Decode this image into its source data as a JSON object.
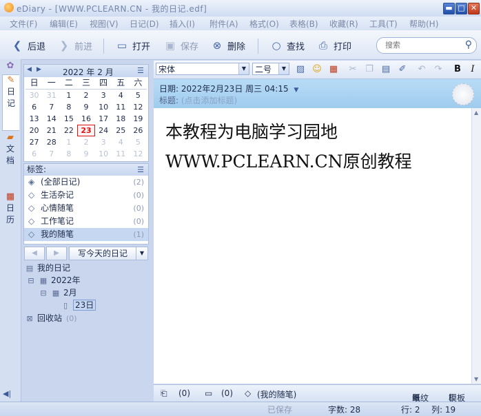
{
  "window": {
    "title": "eDiary - [WWW.PCLEARN.CN - 我的日记.edf]",
    "minimize": "▬",
    "maximize": "□",
    "close": "✕"
  },
  "menu": [
    "文件(F)",
    "编辑(E)",
    "视图(V)",
    "日记(D)",
    "插入(I)",
    "附件(A)",
    "格式(O)",
    "表格(B)",
    "收藏(R)",
    "工具(T)",
    "帮助(H)"
  ],
  "toolbar": {
    "back": "后退",
    "forward": "前进",
    "open": "打开",
    "save": "保存",
    "delete": "删除",
    "find": "查找",
    "print": "打印",
    "search_placeholder": "搜索"
  },
  "side_tabs": [
    "日\n记",
    "文\n档",
    "日\n历"
  ],
  "calendar": {
    "year": "2022",
    "year_label": "年",
    "month": "2",
    "month_label": "月",
    "weekdays": [
      "日",
      "一",
      "二",
      "三",
      "四",
      "五",
      "六"
    ],
    "days": [
      [
        "30",
        "31",
        "1",
        "2",
        "3",
        "4",
        "5"
      ],
      [
        "6",
        "7",
        "8",
        "9",
        "10",
        "11",
        "12"
      ],
      [
        "13",
        "14",
        "15",
        "16",
        "17",
        "18",
        "19"
      ],
      [
        "20",
        "21",
        "22",
        "23",
        "24",
        "25",
        "26"
      ],
      [
        "27",
        "28",
        "1",
        "2",
        "3",
        "4",
        "5"
      ],
      [
        "6",
        "7",
        "8",
        "9",
        "10",
        "11",
        "12"
      ]
    ],
    "today": "23"
  },
  "tags": {
    "header": "标签:",
    "items": [
      {
        "label": "(全部日记)",
        "count": "(2)"
      },
      {
        "label": "生活杂记",
        "count": "(0)"
      },
      {
        "label": "心情随笔",
        "count": "(0)"
      },
      {
        "label": "工作笔记",
        "count": "(0)"
      },
      {
        "label": "我的随笔",
        "count": "(1)"
      }
    ]
  },
  "nav": {
    "prev": "◀",
    "next": "▶",
    "write_today": "写今天的日记",
    "dropdown": "▼"
  },
  "tree": {
    "root": "我的日记",
    "year": "2022年",
    "month": "2月",
    "day": "23日",
    "recycle": "回收站",
    "recycle_count": "(0)"
  },
  "format": {
    "font": "宋体",
    "size": "二号"
  },
  "entry": {
    "date_label": "日期:",
    "date": "2022年2月23日",
    "weekday": "周三",
    "time": "04:15",
    "title_label": "标题:",
    "title_placeholder": "(点击添加标题)",
    "lines": [
      "本教程为电脑学习园地",
      "WWW.PCLEARN.CN原创教程"
    ]
  },
  "entry_status": {
    "attachments": "(0)",
    "comments": "(0)",
    "tag": "(我的随笔)",
    "paper": "纸纹",
    "template": "模板"
  },
  "statusbar": {
    "saved": "已保存",
    "chars": "字数: 28",
    "row": "行: 2",
    "col": "列: 19"
  }
}
